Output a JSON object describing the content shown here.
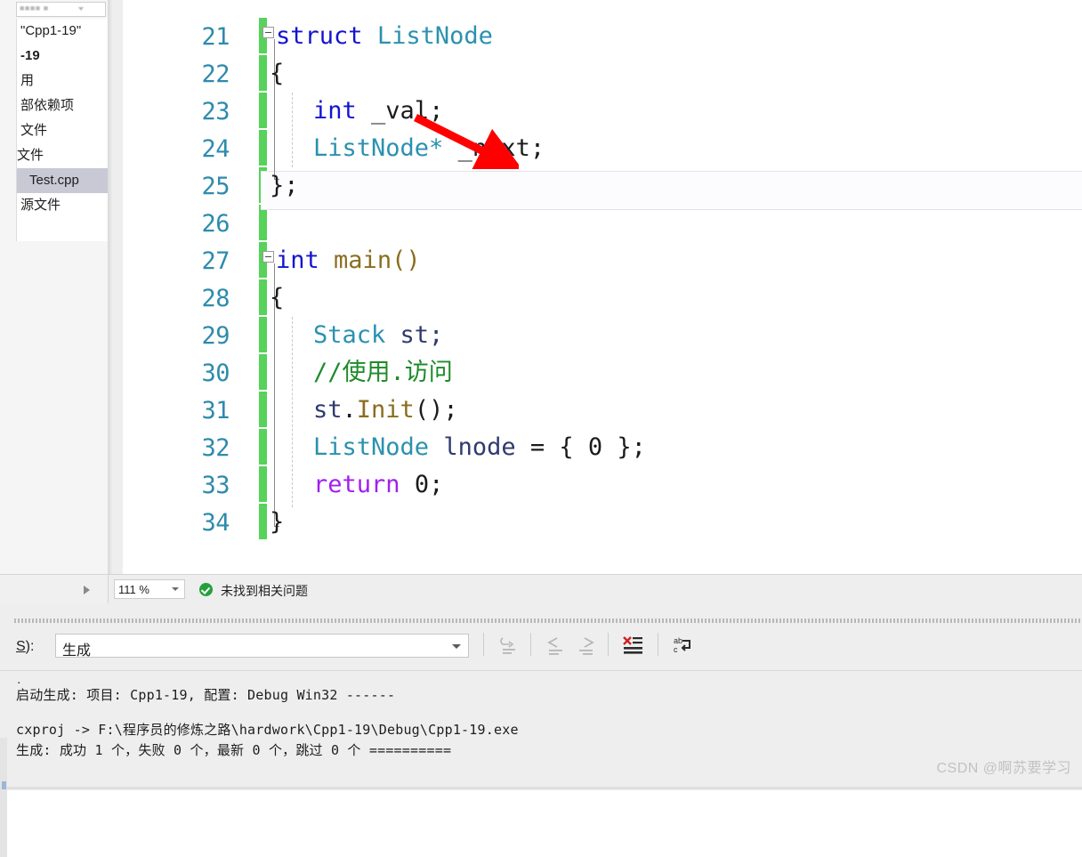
{
  "solution_explorer": {
    "search_placeholder": "搜索解决方案资源管理器",
    "items": [
      {
        "label": "\"Cpp1-19\"",
        "style": "normal"
      },
      {
        "label": "-19",
        "style": "bold"
      },
      {
        "label": "用",
        "style": "normal"
      },
      {
        "label": "部依赖项",
        "style": "normal"
      },
      {
        "label": "文件",
        "style": "normal"
      },
      {
        "label": "文件",
        "style": "normal"
      },
      {
        "label": "Test.cpp",
        "style": "selected"
      },
      {
        "label": "源文件",
        "style": "normal"
      }
    ]
  },
  "editor": {
    "lines": [
      {
        "num": "21",
        "text": "struct ListNode"
      },
      {
        "num": "22",
        "text": "{"
      },
      {
        "num": "23",
        "text": "    int _val;"
      },
      {
        "num": "24",
        "text": "    ListNode* _next;"
      },
      {
        "num": "25",
        "text": "};"
      },
      {
        "num": "26",
        "text": ""
      },
      {
        "num": "27",
        "text": "int main()"
      },
      {
        "num": "28",
        "text": "{"
      },
      {
        "num": "29",
        "text": "    Stack st;"
      },
      {
        "num": "30",
        "text": "    //使用.访问"
      },
      {
        "num": "31",
        "text": "    st.Init();"
      },
      {
        "num": "32",
        "text": "    ListNode lnode = { 0 };"
      },
      {
        "num": "33",
        "text": "    return 0;"
      },
      {
        "num": "34",
        "text": "}"
      }
    ],
    "tokens": {
      "kw_struct": "struct",
      "type_listnode": "ListNode",
      "brace_open": "{",
      "kw_int": "int",
      "ident_val": "_val;",
      "type_listnode_ptr": "ListNode*",
      "ident_next": "_next;",
      "brace_close_semi": "};",
      "fn_main": "main()",
      "type_stack": "Stack",
      "ident_st": "st;",
      "comment_use": "//使用.访问",
      "ident_st2": "st",
      "dot": ".",
      "fn_init": "Init",
      "parens_semi": "();",
      "ident_lnode": "lnode",
      "equals_brace": "= { ",
      "zero": "0",
      "close_brace_semi": " };",
      "kw_return": "return",
      "zero2": "0;",
      "brace_close": "}"
    },
    "annotation": {
      "type": "red-arrow",
      "color": "#ff0000"
    },
    "colors": {
      "keyword": "#1414cf",
      "control_keyword": "#a020f0",
      "type": "#2b91af",
      "function": "#8a6d1e",
      "comment": "#1e8b2a",
      "linenumber": "#2e8bab",
      "changebar": "#57d25a"
    }
  },
  "editor_status": {
    "zoom": "111 %",
    "issue_status": "未找到相关问题"
  },
  "output": {
    "source_label": "S):",
    "source_label_underline": "S",
    "source_value": "生成",
    "toolbar_icons": [
      "clear-output-icon",
      "go-to-previous-message-icon",
      "go-to-next-message-icon",
      "clear-all-icon",
      "toggle-word-wrap-icon"
    ],
    "console_lines": [
      ".",
      "启动生成: 项目: Cpp1-19, 配置: Debug Win32 ------",
      "",
      "cxproj -> F:\\程序员的修炼之路\\hardwork\\Cpp1-19\\Debug\\Cpp1-19.exe",
      "生成: 成功 1 个，失败 0 个，最新 0 个，跳过 0 个 =========="
    ]
  },
  "watermark": {
    "text": "CSDN @啊苏要学习"
  }
}
